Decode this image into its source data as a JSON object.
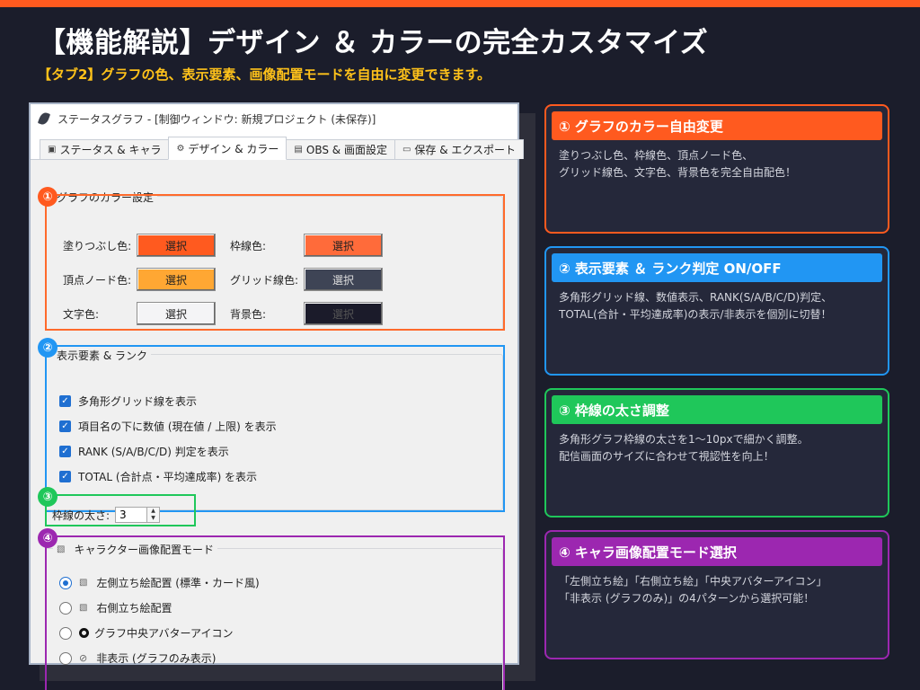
{
  "header": {
    "title": "【機能解説】デザイン ＆ カラーの完全カスタマイズ",
    "subtitle": "【タブ2】グラフの色、表示要素、画像配置モードを自由に変更できます。"
  },
  "colors": {
    "accent_orange": "#ff5a1f",
    "accent_blue": "#2196f3",
    "accent_green": "#1fc75a",
    "accent_purple": "#9c27b0",
    "subtitle_yellow": "#ffc21a",
    "background": "#1b1d2b"
  },
  "window": {
    "title": "ステータスグラフ - [制御ウィンドウ: 新規プロジェクト (未保存)]",
    "app_icon": "feather-icon",
    "tabs": [
      {
        "label": "ステータス & キャラ",
        "icon": "chart-icon"
      },
      {
        "label": "デザイン & カラー",
        "icon": "gear-icon",
        "active": true
      },
      {
        "label": "OBS & 画面設定",
        "icon": "monitor-icon"
      },
      {
        "label": "保存 & エクスポート",
        "icon": "folder-icon"
      }
    ]
  },
  "colorSettings": {
    "badge": "①",
    "title": "グラフのカラー設定",
    "button_label": "選択",
    "fill": {
      "label": "塗りつぶし色:",
      "color": "#ff5a1f"
    },
    "border": {
      "label": "枠線色:",
      "color": "#ff6b3a"
    },
    "vertex": {
      "label": "頂点ノード色:",
      "color": "#ffa733"
    },
    "grid": {
      "label": "グリッド線色:",
      "color": "#3e4455"
    },
    "text": {
      "label": "文字色:",
      "color": "#f4f4f6"
    },
    "bg": {
      "label": "背景色:",
      "color": "#1b1b2a"
    }
  },
  "displayElements": {
    "badge": "②",
    "title": "表示要素 & ランク",
    "options": [
      {
        "label": "多角形グリッド線を表示",
        "checked": true
      },
      {
        "label": "項目名の下に数値 (現在値 / 上限) を表示",
        "checked": true
      },
      {
        "label": "RANK (S/A/B/C/D) 判定を表示",
        "checked": true
      },
      {
        "label": "TOTAL (合計点・平均達成率) を表示",
        "checked": true
      }
    ]
  },
  "borderWidth": {
    "badge": "③",
    "label": "枠線の太さ:",
    "value": "3"
  },
  "imageMode": {
    "badge": "④",
    "title": "キャラクター画像配置モード",
    "title_icon": "image-icon",
    "options": [
      {
        "label": "左側立ち絵配置 (標準・カード風)",
        "icon": "image-icon",
        "selected": true
      },
      {
        "label": "右側立ち絵配置",
        "icon": "image-icon",
        "selected": false
      },
      {
        "label": "グラフ中央アバターアイコン",
        "icon": "ring-icon",
        "selected": false
      },
      {
        "label": "非表示 (グラフのみ表示)",
        "icon": "prohibited-icon",
        "selected": false
      }
    ]
  },
  "panels": [
    {
      "heading": "① グラフのカラー自由変更",
      "body": "塗りつぶし色、枠線色、頂点ノード色、\nグリッド線色、文字色、背景色を完全自由配色！"
    },
    {
      "heading": "② 表示要素 ＆ ランク判定 ON/OFF",
      "body": "多角形グリッド線、数値表示、RANK(S/A/B/C/D)判定、\nTOTAL(合計・平均達成率)の表示/非表示を個別に切替！"
    },
    {
      "heading": "③ 枠線の太さ調整",
      "body": "多角形グラフ枠線の太さを1〜10pxで細かく調整。\n配信画面のサイズに合わせて視認性を向上！"
    },
    {
      "heading": "④ キャラ画像配置モード選択",
      "body": "「左側立ち絵」「右側立ち絵」「中央アバターアイコン」\n「非表示 (グラフのみ)」の4パターンから選択可能！"
    }
  ]
}
